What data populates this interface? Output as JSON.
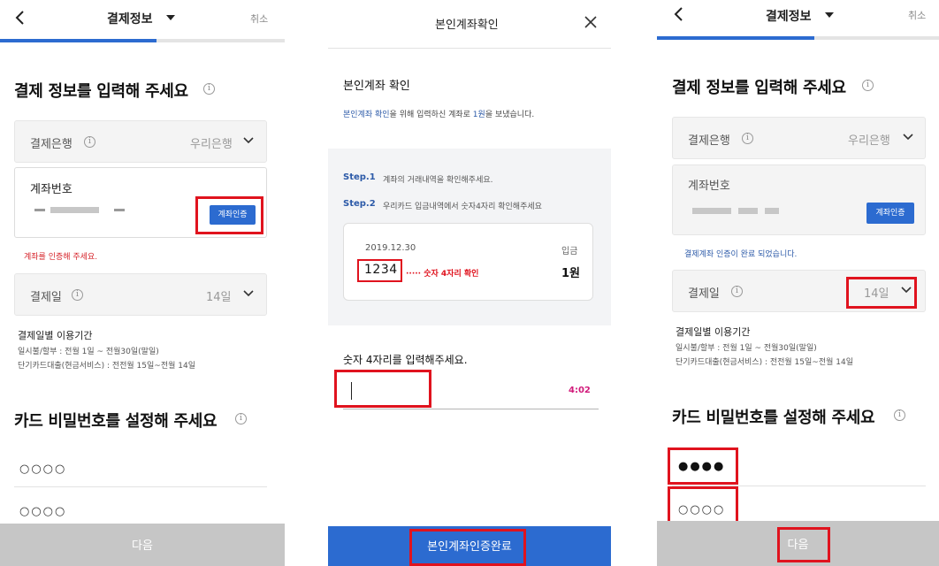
{
  "screen1": {
    "header": {
      "title": "결제정보",
      "cancel": "취소"
    },
    "page_title": "결제 정보를 입력해 주세요",
    "bank_field": {
      "label": "결제은행",
      "value": "우리은행"
    },
    "account_field": {
      "label": "계좌번호",
      "button": "계좌인증"
    },
    "account_error": "계좌를 인증해 주세요.",
    "payday_field": {
      "label": "결제일",
      "value": "14일"
    },
    "period": {
      "title": "결제일별 이용기간",
      "line1": "일시불/할부 : 전월 1일 ~ 전월30일(말일)",
      "line2": "단기카드대출(현금서비스) : 전전월 15일~전월 14일"
    },
    "password_title": "카드 비밀번호를 설정해 주세요",
    "pin1": "○○○○",
    "pin2": "○○○○",
    "next_button": "다음"
  },
  "screen2": {
    "header": {
      "title": "본인계좌확인"
    },
    "heading": "본인계좌 확인",
    "desc_blue1": "본인계좌 확인",
    "desc_text1": "을 위해 입력하신 계좌로 ",
    "desc_blue2": "1원",
    "desc_text2": "을 보냈습니다.",
    "step1": {
      "label": "Step.1",
      "text": "계좌의 거래내역을 확인해주세요."
    },
    "step2": {
      "label": "Step.2",
      "text": "우리카드 입금내역에서 숫자4자리 확인해주세요"
    },
    "transaction": {
      "date": "2019.12.30",
      "type": "입금",
      "code": "1234",
      "hint": "····· 숫자 4자리 확인",
      "amount": "1원"
    },
    "input_prompt": "숫자 4자리를 입력해주세요.",
    "timer": "4:02",
    "complete_button": "본인계좌인증완료"
  },
  "screen3": {
    "header": {
      "title": "결제정보",
      "cancel": "취소"
    },
    "page_title": "결제 정보를 입력해 주세요",
    "bank_field": {
      "label": "결제은행",
      "value": "우리은행"
    },
    "account_field": {
      "label": "계좌번호",
      "button": "계좌인증"
    },
    "account_ok": "결제계좌 인증이 완료 되었습니다.",
    "payday_field": {
      "label": "결제일",
      "value": "14일"
    },
    "period": {
      "title": "결제일별 이용기간",
      "line1": "일시불/할부 : 전월 1일 ~ 전월30일(말일)",
      "line2": "단기카드대출(현금서비스) : 전전월 15일~전월 14일"
    },
    "password_title": "카드 비밀번호를 설정해 주세요",
    "pin1": "●●●●",
    "pin2": "○○○○",
    "next_button": "다음"
  },
  "colors": {
    "accent": "#2c6bd0",
    "highlight": "#e0131e",
    "error": "#d6232a",
    "timer": "#d11a7a"
  },
  "icons": [
    "back-arrow-icon",
    "caret-down-icon",
    "info-icon",
    "chevron-down-icon",
    "close-icon"
  ]
}
